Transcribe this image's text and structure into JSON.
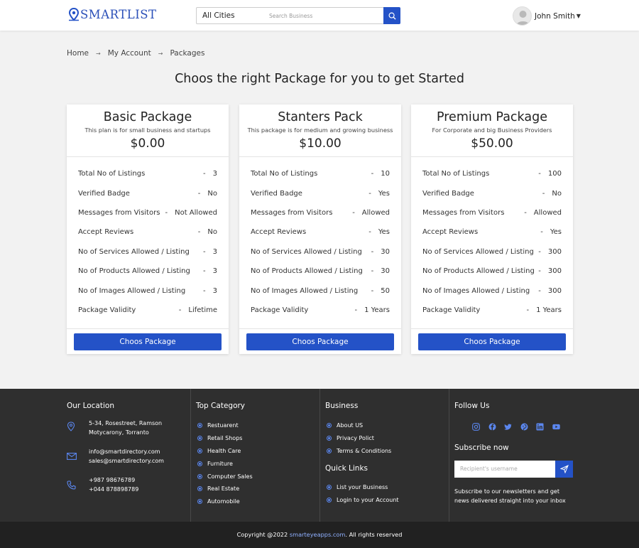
{
  "brand": {
    "name": "SMARTLIST",
    "color": "#2452c7"
  },
  "header": {
    "city_select": "All Cities",
    "search_placeholder": "Search Business",
    "user_name": "John Smith"
  },
  "breadcrumb": {
    "items": [
      "Home",
      "My Account",
      "Packages"
    ]
  },
  "page_title": "Choos the right Package for you to get Started",
  "packages": [
    {
      "name": "Basic Package",
      "desc": "This plan is for small business and startups",
      "price": "$0.00",
      "button": "Choos Package",
      "rows": [
        {
          "label": "Total No of Listings",
          "value": "3"
        },
        {
          "label": "Verified Badge",
          "value": "No"
        },
        {
          "label": "Messages from Visitors",
          "value": "Not Allowed"
        },
        {
          "label": "Accept Reviews",
          "value": "No"
        },
        {
          "label": "No of Services Allowed / Listing",
          "value": "3"
        },
        {
          "label": "No of Products Allowed / Listing",
          "value": "3"
        },
        {
          "label": "No of Images Allowed / Listing",
          "value": "3"
        },
        {
          "label": "Package Validity",
          "value": "Lifetime"
        }
      ]
    },
    {
      "name": "Stanters Pack",
      "desc": "This package is for medium and growing business",
      "price": "$10.00",
      "button": "Choos Package",
      "rows": [
        {
          "label": "Total No of Listings",
          "value": "10"
        },
        {
          "label": "Verified Badge",
          "value": "Yes"
        },
        {
          "label": "Messages from Visitors",
          "value": "Allowed"
        },
        {
          "label": "Accept Reviews",
          "value": "Yes"
        },
        {
          "label": "No of Services Allowed / Listing",
          "value": "30"
        },
        {
          "label": "No of Products Allowed / Listing",
          "value": "30"
        },
        {
          "label": "No of Images Allowed / Listing",
          "value": "50"
        },
        {
          "label": "Package Validity",
          "value": "1 Years"
        }
      ]
    },
    {
      "name": "Premium Package",
      "desc": "For Corporate and big Business Providers",
      "price": "$50.00",
      "button": "Choos Package",
      "rows": [
        {
          "label": "Total No of Listings",
          "value": "100"
        },
        {
          "label": "Verified Badge",
          "value": "No"
        },
        {
          "label": "Messages from Visitors",
          "value": "Allowed"
        },
        {
          "label": "Accept Reviews",
          "value": "Yes"
        },
        {
          "label": "No of Services Allowed / Listing",
          "value": "300"
        },
        {
          "label": "No of Products Allowed / Listing",
          "value": "300"
        },
        {
          "label": "No of Images Allowed / Listing",
          "value": "300"
        },
        {
          "label": "Package Validity",
          "value": "1 Years"
        }
      ]
    }
  ],
  "footer": {
    "location": {
      "title": "Our Location",
      "address_1": "5-34, Rosestreet, Ramson",
      "address_2": "Motycarony, Torranto",
      "email_1": "info@smartdirectory.com",
      "email_2": "sales@smartdirectory.com",
      "phone_1": "+987 98676789",
      "phone_2": "+044 878898789"
    },
    "top_category": {
      "title": "Top Category",
      "items": [
        "Restuarent",
        "Retail Shops",
        "Health Care",
        "Furniture",
        "Computer Sales",
        "Real Estate",
        "Automobile"
      ]
    },
    "business": {
      "title": "Business",
      "items": [
        "About US",
        "Privacy Polict",
        "Terms & Conditions"
      ]
    },
    "quick_links": {
      "title": "Quick Links",
      "items": [
        "List your Business",
        "Login to your Account"
      ]
    },
    "follow": {
      "title": "Follow Us",
      "icons": [
        "instagram-icon",
        "facebook-icon",
        "twitter-icon",
        "pinterest-icon",
        "linkedin-icon",
        "youtube-icon"
      ]
    },
    "subscribe": {
      "title": "Subscribe now",
      "placeholder": "Recipient's username",
      "text": "Subscribe to our newsletters and get news delivered straight into your inbox"
    },
    "copyright_prefix": "Copyright @2022",
    "copyright_link": "smarteyeapps.com",
    "copyright_suffix": ". All rights reserved"
  }
}
